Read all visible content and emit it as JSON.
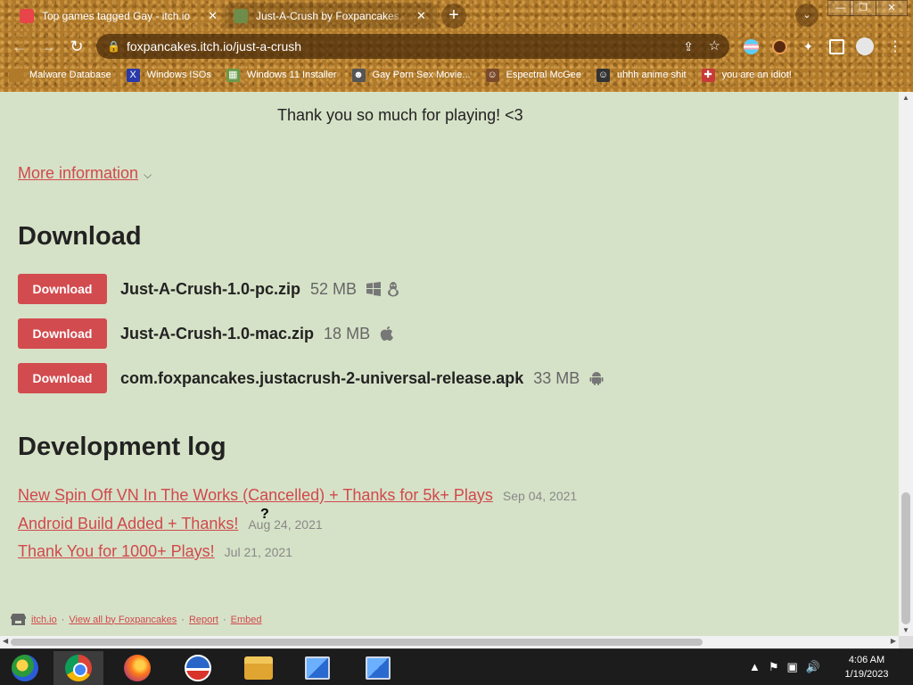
{
  "browser": {
    "tabs": [
      {
        "title": "Top games tagged Gay - itch.io",
        "close": "✕"
      },
      {
        "title": "Just-A-Crush by Foxpancakes, be",
        "close": "✕"
      }
    ],
    "new_tab": "+",
    "tab_search": "⌄",
    "window_controls": {
      "minimize": "—",
      "maximize": "❐",
      "close": "✕"
    },
    "nav": {
      "back": "←",
      "forward": "→",
      "reload": "↻"
    },
    "url": "foxpancakes.itch.io/just-a-crush",
    "bookmarks": [
      {
        "label": "Malware Database",
        "icon": "",
        "color": "#b07a2a"
      },
      {
        "label": "Windows ISOs",
        "icon": "X",
        "color": "#2a3aa8"
      },
      {
        "label": "Windows 11 Installer",
        "icon": "▦",
        "color": "#6a9a4a"
      },
      {
        "label": "Gay Porn Sex Movie...",
        "icon": "☻",
        "color": "#555"
      },
      {
        "label": "Espectral McGee",
        "icon": "☺",
        "color": "#7a4a2a"
      },
      {
        "label": "uhhh anime shit",
        "icon": "☺",
        "color": "#333"
      },
      {
        "label": "you are an idiot!",
        "icon": "✚",
        "color": "#c83a3a"
      }
    ]
  },
  "page": {
    "thanks": "Thank you so much for playing! <3",
    "more_info": "More information",
    "download_heading": "Download",
    "downloads": [
      {
        "button": "Download",
        "name": "Just-A-Crush-1.0-pc.zip",
        "size": "52 MB",
        "platforms": [
          "windows-icon",
          "linux-icon"
        ]
      },
      {
        "button": "Download",
        "name": "Just-A-Crush-1.0-mac.zip",
        "size": "18 MB",
        "platforms": [
          "apple-icon"
        ]
      },
      {
        "button": "Download",
        "name": "com.foxpancakes.justacrush-2-universal-release.apk",
        "size": "33 MB",
        "platforms": [
          "android-icon"
        ]
      }
    ],
    "devlog_heading": "Development log",
    "devlog": [
      {
        "title": "New Spin Off VN In The Works (Cancelled) + Thanks for 5k+ Plays",
        "date": "Sep 04, 2021"
      },
      {
        "title": "Android Build Added + Thanks!",
        "date": "Aug 24, 2021"
      },
      {
        "title": "Thank You for 1000+ Plays!",
        "date": "Jul 21, 2021"
      }
    ],
    "footer": {
      "itch": "itch.io",
      "view_all": "View all by Foxpancakes",
      "report": "Report",
      "embed": "Embed",
      "sep": "·"
    }
  },
  "cursor": "?",
  "taskbar": {
    "clock_time": "4:06 AM",
    "clock_date": "1/19/2023",
    "tray": [
      "▲",
      "⚑",
      "▣",
      "🔊"
    ]
  }
}
